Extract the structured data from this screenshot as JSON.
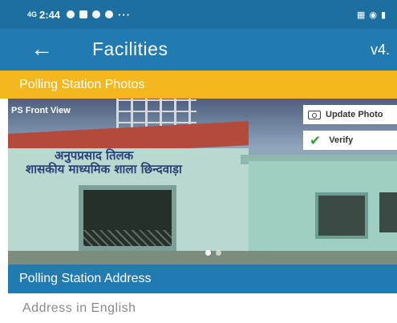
{
  "status_bar": {
    "network": "4G",
    "time": "2:44",
    "more": "···"
  },
  "app_bar": {
    "back_icon": "arrow-left-icon",
    "title": "Facilities",
    "version": "v4."
  },
  "photos_section": {
    "title": "Polling Station Photos",
    "photo_label": "PS Front View",
    "update_label": "Update Photo",
    "verify_label": "Verify",
    "sign_line1": "अनुपप्रसाद तिलक",
    "sign_line2": "शासकीय माध्यमिक शाला छिन्दवाड़ा",
    "pager_count": 2,
    "pager_active": 1
  },
  "address_section": {
    "title": "Polling Station Address",
    "field_label": "Address in English"
  },
  "colors": {
    "status_bar": "#1c6f9f",
    "app_bar": "#217ab0",
    "photos_header": "#f4b81e",
    "verify_check": "#2e9d3a"
  }
}
